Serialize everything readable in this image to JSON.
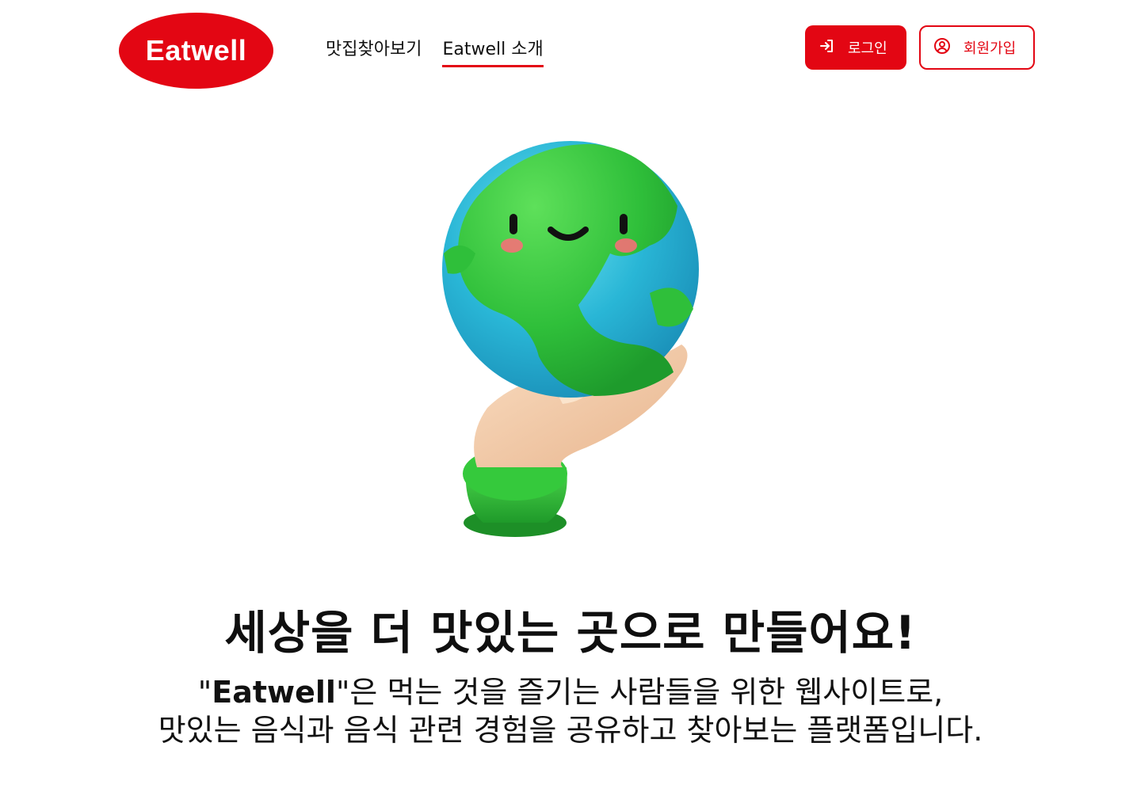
{
  "app": {
    "logo_text": "Eatwell",
    "brand_color": "#e30613"
  },
  "nav": {
    "items": [
      {
        "label": "맛집찾아보기",
        "active": false
      },
      {
        "label": "Eatwell 소개",
        "active": true
      }
    ]
  },
  "auth": {
    "login_label": "로그인",
    "login_icon": "login-arrow-icon",
    "signup_label": "회원가입",
    "signup_icon": "user-circle-icon"
  },
  "hero": {
    "image": "smiling-earth-in-hand-illustration"
  },
  "content": {
    "headline": "세상을 더 맛있는 곳으로 만들어요!",
    "quote_open": "\"",
    "brand_name": "Eatwell",
    "line1_rest": "\"은 먹는 것을 즐기는 사람들을 위한 웹사이트로,",
    "line2": "맛있는 음식과 음식 관련 경험을 공유하고 찾아보는 플랫폼입니다."
  }
}
